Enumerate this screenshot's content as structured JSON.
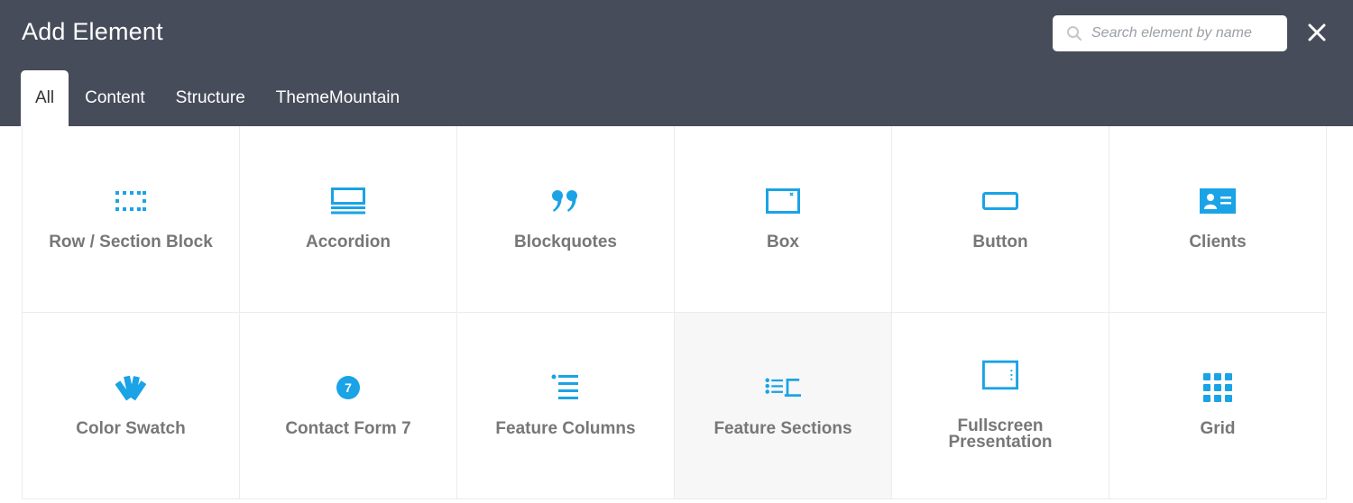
{
  "header": {
    "title": "Add Element",
    "search_placeholder": "Search element by name",
    "search_value": "",
    "bg_color": "#474c5a"
  },
  "tabs": [
    {
      "label": "All",
      "active": true
    },
    {
      "label": "Content",
      "active": false
    },
    {
      "label": "Structure",
      "active": false
    },
    {
      "label": "ThemeMountain",
      "active": false
    }
  ],
  "accent_color": "#1aa3e6",
  "elements": [
    {
      "label": "Row / Section Block",
      "icon": "row-dots-icon"
    },
    {
      "label": "Accordion",
      "icon": "accordion-icon"
    },
    {
      "label": "Blockquotes",
      "icon": "quote-icon"
    },
    {
      "label": "Box",
      "icon": "box-icon"
    },
    {
      "label": "Button",
      "icon": "button-icon"
    },
    {
      "label": "Clients",
      "icon": "id-card-icon"
    },
    {
      "label": "Color Swatch",
      "icon": "swatch-fan-icon"
    },
    {
      "label": "Contact Form 7",
      "icon": "badge-seven-icon",
      "badge": "7"
    },
    {
      "label": "Feature Columns",
      "icon": "list-icon"
    },
    {
      "label": "Feature Sections",
      "icon": "list-laptop-icon"
    },
    {
      "label": "Fullscreen Presentation",
      "icon": "presentation-icon"
    },
    {
      "label": "Grid",
      "icon": "grid-icon"
    }
  ]
}
